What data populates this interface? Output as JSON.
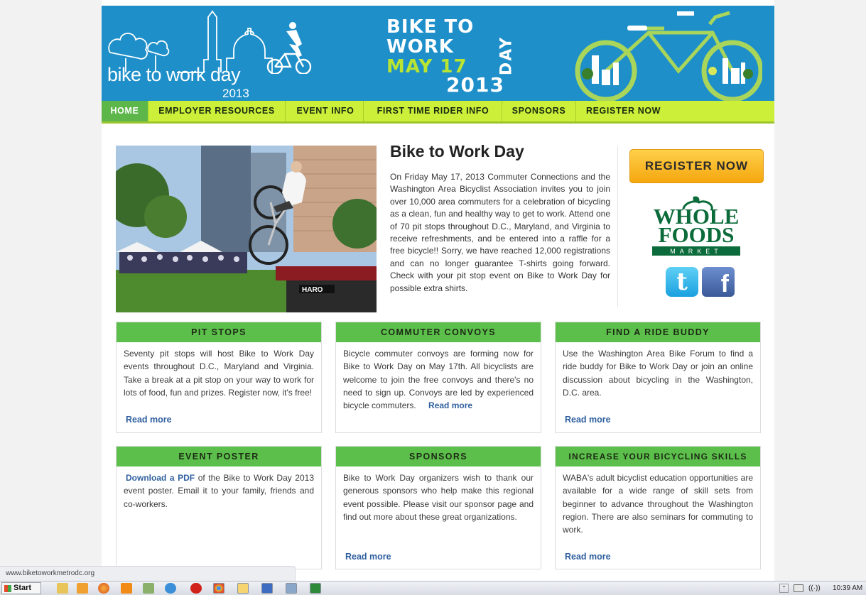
{
  "browser": {
    "status_url": "www.biketoworkmetrodc.org"
  },
  "banner": {
    "logo_text": "bike to work day",
    "logo_year": "2013",
    "headline_line1": "BIKE TO",
    "headline_line2": "WORK",
    "headline_line3": "MAY 17",
    "headline_line4": "2013",
    "headline_vertical": "DAY"
  },
  "nav": {
    "items": [
      "HOME",
      "EMPLOYER RESOURCES",
      "EVENT INFO",
      "FIRST TIME RIDER INFO",
      "SPONSORS",
      "REGISTER NOW"
    ],
    "active": "HOME"
  },
  "main": {
    "title": "Bike to Work Day",
    "body": "On Friday May 17, 2013 Commuter Connections and the Washington Area Bicyclist Association invites you to join over 10,000 area commuters for a celebration of bicycling as a clean, fun and healthy way to get to work. Attend one of 70 pit stops throughout D.C., Maryland, and Virginia to receive refreshments, and be entered into a raffle for a free bicycle!! Sorry, we have reached 12,000 registrations and can no longer guarantee T-shirts going forward. Check with your pit stop event on Bike to Work Day for possible extra shirts.",
    "photo_banner_text": "HARO"
  },
  "sidebar": {
    "register_button": "REGISTER NOW",
    "sponsor_line1": "WHOLE",
    "sponsor_line2": "FOODS",
    "sponsor_line3": "MARKET",
    "twitter_icon_glyph": "t",
    "facebook_icon_glyph": "f"
  },
  "cards": {
    "pit_stops": {
      "title": "PIT STOPS",
      "body": "Seventy pit stops will host Bike to Work Day events throughout D.C., Maryland and Virginia. Take a break at a pit stop on your way to work for lots of food, fun and prizes. Register now, it's free!",
      "link": "Read more"
    },
    "convoys": {
      "title": "COMMUTER CONVOYS",
      "body": "Bicycle commuter convoys are forming now for Bike to Work Day on May 17th. All bicyclists are welcome to join the free convoys and there's no need to sign up. Convoys are led by experienced bicycle commuters.",
      "link": "Read more"
    },
    "ride_buddy": {
      "title": "FIND A RIDE BUDDY",
      "body": "Use the Washington Area Bike Forum to find a ride buddy for Bike to Work Day or join an online discussion about bicycling in the Washington, D.C. area.",
      "link": "Read more"
    },
    "event_poster": {
      "title": "EVENT POSTER",
      "link_text": "Download a PDF",
      "body": " of the Bike to Work Day 2013 event poster. Email it to your family, friends and co-workers."
    },
    "sponsors": {
      "title": "SPONSORS",
      "body": "Bike to Work Day organizers wish to thank our generous sponsors who help make this regional event possible. Please visit our sponsor page and find out more about these great organizations.",
      "link": "Read more"
    },
    "skills": {
      "title": "INCREASE YOUR BICYCLING SKILLS",
      "body": "WABA's adult bicyclist education opportunities are available for a wide range of skill sets from beginner to advance throughout the Washington region. There are also seminars for commuting to work.",
      "link": "Read more"
    }
  },
  "taskbar": {
    "start_label": "Start",
    "clock": "10:39 AM",
    "tray_volume": "((·))",
    "tray_arrow": "⌃",
    "icons": [
      "folder-icon",
      "media-player-icon",
      "firefox-icon",
      "vlc-icon",
      "network-icon",
      "ie-icon",
      "opera-icon",
      "chrome-icon",
      "window-icon",
      "word-icon",
      "screen-icon",
      "excel-icon"
    ]
  },
  "colors": {
    "banner_blue": "#1e8fc9",
    "nav_lime": "#ccf03a",
    "nav_active_green": "#5db64a",
    "card_header_green": "#5cbf4b",
    "link_blue": "#2f5f9e",
    "register_orange": "#f5a60e",
    "whole_foods_green": "#0c6b3a"
  }
}
